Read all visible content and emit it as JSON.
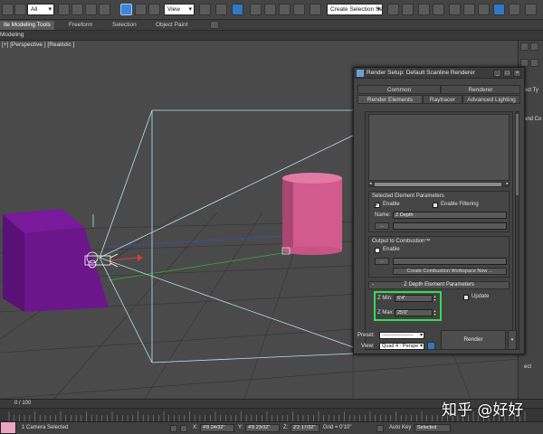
{
  "toolbar": {
    "selection_filter": "All",
    "reference_coord": "View",
    "named_selection": "Create Selection Se"
  },
  "ribbon": {
    "tabs": [
      {
        "label": "ite Modeling Tools"
      },
      {
        "label": "Freeform"
      },
      {
        "label": "Selection"
      },
      {
        "label": "Object Paint"
      }
    ],
    "sub_label": "Modeling"
  },
  "viewport": {
    "label": "[+] [Perspective ] [Realistic ]"
  },
  "command_panel": {
    "snippets": [
      "ect Ty",
      "and Co",
      "ect"
    ]
  },
  "dialog": {
    "title": "Render Setup: Default Scanline Renderer",
    "tabs_row1": [
      {
        "label": "Common"
      },
      {
        "label": "Renderer"
      }
    ],
    "tabs_row2": [
      {
        "label": "Render Elements"
      },
      {
        "label": "Raytracer"
      },
      {
        "label": "Advanced Lighting"
      }
    ],
    "selected_element": {
      "title": "Selected Element Parameters",
      "enable_label": "Enable",
      "enable_filtering_label": "Enable Filtering",
      "name_label": "Name:",
      "name_value": "Z Depth",
      "browse_label": "..."
    },
    "combustion": {
      "title": "Output to Combustion™",
      "enable_label": "Enable",
      "browse_label": "...",
      "create_button": "Create Combustion Workspace Now ..."
    },
    "zdepth": {
      "rollout_title": "Z Depth Element Parameters",
      "collapse_symbol": "-",
      "zmin_label": "Z Min:",
      "zmin_value": "6'4\"",
      "zmax_label": "Z Max:",
      "zmax_value": "25'0\"",
      "update_label": "Update"
    },
    "footer": {
      "preset_label": "Preset:",
      "preset_value": "-------------------",
      "view_label": "View:",
      "view_value": "Quad 4 - Perspe",
      "render_label": "Render"
    }
  },
  "timeline": {
    "frame_label": "0 / 100"
  },
  "statusbar": {
    "selection_text": "1 Camera Selected",
    "x_label": "X:",
    "x_value": "4'8 24/32\"",
    "y_label": "Y:",
    "y_value": "4'8 23/32\"",
    "z_label": "Z:",
    "z_value": "2'2 17/32\"",
    "grid_text": "Grid = 0'10\"",
    "autokey_label": "Auto Key",
    "autokey_value": "Selected"
  },
  "watermark": "知乎 @好好",
  "colors": {
    "highlight_box": "#2ee24a",
    "cylinder": "#d35a8c",
    "cube": "#6c168c",
    "frustum": "#b9e4ec"
  }
}
